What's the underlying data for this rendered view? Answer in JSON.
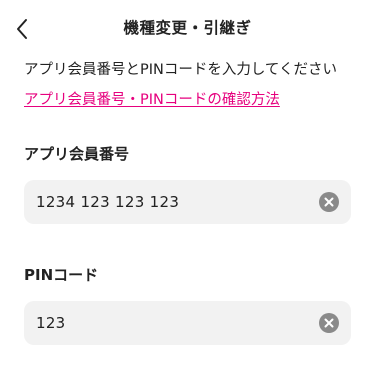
{
  "header": {
    "title": "機種変更・引継ぎ",
    "back_icon": "chevron-left-icon"
  },
  "intro": {
    "text": "アプリ会員番号とPINコードを入力してください"
  },
  "help_link": {
    "text": "アプリ会員番号・PINコードの確認方法",
    "color": "#e6007e"
  },
  "member_field": {
    "label": "アプリ会員番号",
    "value": "1234 123 123 123",
    "clear_icon": "clear-circle-icon"
  },
  "pin_field": {
    "label": "PINコード",
    "value": "123",
    "clear_icon": "clear-circle-icon"
  }
}
